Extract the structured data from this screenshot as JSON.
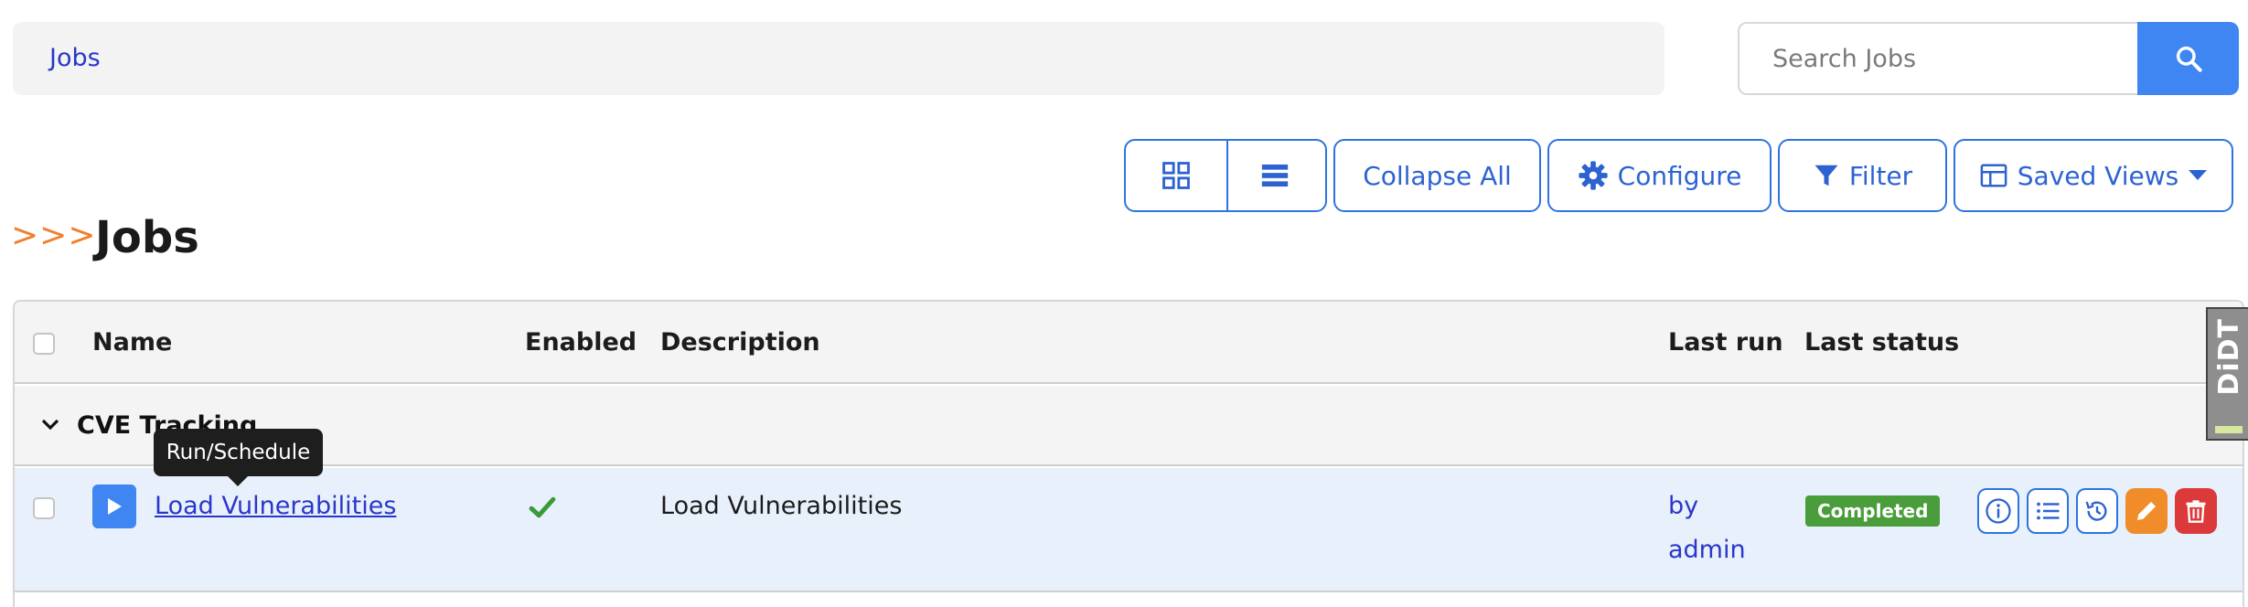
{
  "breadcrumb": {
    "label": "Jobs"
  },
  "search": {
    "placeholder": "Search Jobs",
    "icon": "search-icon"
  },
  "toolbar": {
    "grid_view_icon": "grid-icon",
    "list_view_icon": "list-icon",
    "collapse_all_label": "Collapse All",
    "configure_label": "Configure",
    "filter_label": "Filter",
    "saved_views_label": "Saved Views"
  },
  "page": {
    "chevrons": ">>>",
    "title": "Jobs"
  },
  "table": {
    "headers": {
      "name": "Name",
      "enabled": "Enabled",
      "description": "Description",
      "last_run": "Last run",
      "last_status": "Last status"
    },
    "groups": [
      {
        "name": "CVE Tracking",
        "jobs": [
          {
            "name": "Load Vulnerabilities",
            "enabled": true,
            "description": "Load Vulnerabilities",
            "last_run_line1": "by",
            "last_run_line2": "admin",
            "last_status": "Completed"
          }
        ]
      }
    ]
  },
  "tooltip": {
    "text": "Run/Schedule"
  },
  "side_tab": {
    "text": "DiDT"
  },
  "colors": {
    "primary": "#3f86f2",
    "link": "#2a37c9",
    "accent_orange": "#f08c2a",
    "danger": "#dc3a3a",
    "success": "#4a9d3b"
  }
}
